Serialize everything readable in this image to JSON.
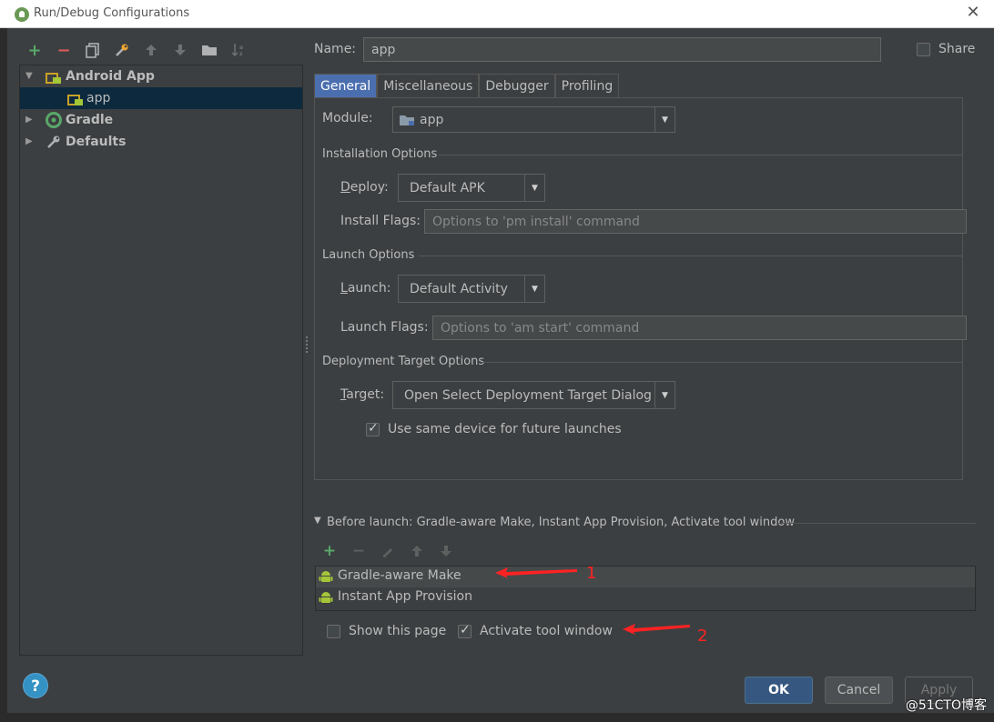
{
  "window": {
    "title": "Run/Debug Configurations"
  },
  "toolbar": {
    "icons": [
      "add-icon",
      "remove-icon",
      "copy-icon",
      "wrench-icon",
      "move-up-icon",
      "move-down-icon",
      "folder-icon",
      "sort-icon"
    ]
  },
  "tree": {
    "items": [
      {
        "label": "Android App",
        "expanded": true
      },
      {
        "label": "app",
        "selected": true
      },
      {
        "label": "Gradle",
        "expanded": false
      },
      {
        "label": "Defaults",
        "expanded": false
      }
    ]
  },
  "name_field": {
    "label": "Name:",
    "value": "app"
  },
  "share": {
    "label": "Share",
    "checked": false
  },
  "tabs": [
    "General",
    "Miscellaneous",
    "Debugger",
    "Profiling"
  ],
  "general": {
    "module_label": "Module:",
    "module_value": "app",
    "installation_section": "Installation Options",
    "deploy_label": "Deploy:",
    "deploy_value": "Default APK",
    "install_flags_label": "Install Flags:",
    "install_flags_placeholder": "Options to 'pm install' command",
    "launch_section": "Launch Options",
    "launch_label": "Launch:",
    "launch_value": "Default Activity",
    "launch_flags_label": "Launch Flags:",
    "launch_flags_placeholder": "Options to 'am start' command",
    "deployment_section": "Deployment Target Options",
    "target_label": "Target:",
    "target_value": "Open Select Deployment Target Dialog",
    "same_device_label": "Use same device for future launches",
    "same_device_checked": true
  },
  "before_launch": {
    "header": "Before launch: Gradle-aware Make, Instant App Provision, Activate tool window",
    "items": [
      "Gradle-aware Make",
      "Instant App Provision"
    ],
    "show_page_label": "Show this page",
    "show_page_checked": false,
    "activate_label": "Activate tool window",
    "activate_checked": true
  },
  "annotations": {
    "one": "1",
    "two": "2"
  },
  "buttons": {
    "ok": "OK",
    "cancel": "Cancel",
    "apply": "Apply",
    "help": "?"
  },
  "colors": {
    "background": "#3c3f41",
    "selection": "#0d293e",
    "active_tab": "#4b6eaf",
    "ok_button": "#365880",
    "annotation": "#ff2222"
  },
  "watermark": "@51CTO博客"
}
